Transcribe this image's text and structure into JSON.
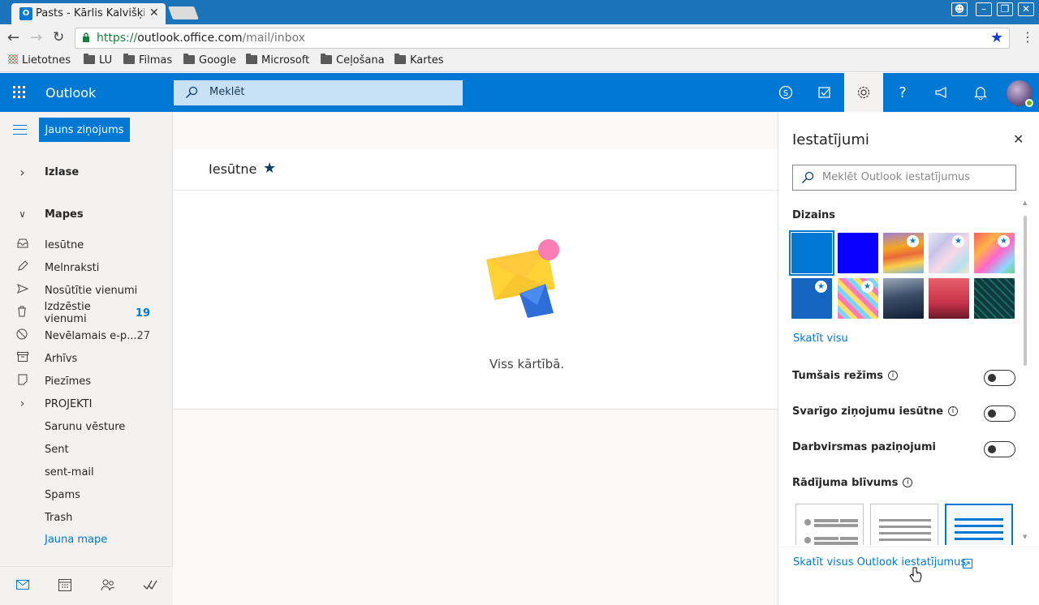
{
  "browser": {
    "tab_title": "Pasts - Kārlis Kalvišķi",
    "url_scheme": "https://",
    "url_host": "outlook.office.com",
    "url_path": "/mail/inbox",
    "bookmarks": [
      "Lietotnes",
      "LU",
      "Filmas",
      "Google",
      "Microsoft",
      "Ceļošana",
      "Kartes"
    ]
  },
  "header": {
    "app_name": "Outlook",
    "search_placeholder": "Meklēt",
    "accent_color": "#0078d4"
  },
  "left_nav": {
    "new_message": "Jauns ziņojums",
    "favorites": "Izlase",
    "folders_header": "Mapes",
    "folders": [
      {
        "label": "Iesūtne",
        "icon": "inbox-icon",
        "count": ""
      },
      {
        "label": "Melnraksti",
        "icon": "pencil-icon",
        "count": ""
      },
      {
        "label": "Nosūtītie vienumi",
        "icon": "send-icon",
        "count": ""
      },
      {
        "label": "Izdzēstie vienumi",
        "icon": "trash-icon",
        "count": "19"
      },
      {
        "label": "Nevēlamais e-p...",
        "icon": "block-icon",
        "count": "27"
      },
      {
        "label": "Arhīvs",
        "icon": "archive-icon",
        "count": ""
      },
      {
        "label": "Piezīmes",
        "icon": "note-icon",
        "count": ""
      },
      {
        "label": "PROJEKTI",
        "icon": "chevron-right-icon",
        "count": ""
      },
      {
        "label": "Sarunu vēsture",
        "icon": "",
        "count": ""
      },
      {
        "label": "Sent",
        "icon": "",
        "count": ""
      },
      {
        "label": "sent-mail",
        "icon": "",
        "count": ""
      },
      {
        "label": "Spams",
        "icon": "",
        "count": ""
      },
      {
        "label": "Trash",
        "icon": "",
        "count": ""
      }
    ],
    "new_folder": "Jauna mape"
  },
  "main": {
    "title": "Iesūtne",
    "empty_text": "Viss kārtībā."
  },
  "settings": {
    "title": "Iestatījumi",
    "search_placeholder": "Meklēt Outlook iestatījumus",
    "theme_header": "Dizains",
    "see_all": "Skatīt visu",
    "dark_mode": "Tumšais režīms",
    "focused_inbox": "Svarīgo ziņojumu iesūtne",
    "desktop_notifications": "Darbvirsmas paziņojumi",
    "density_header": "Rādījuma blīvums",
    "all_settings": "Skatīt visus Outlook iestatījumus"
  }
}
